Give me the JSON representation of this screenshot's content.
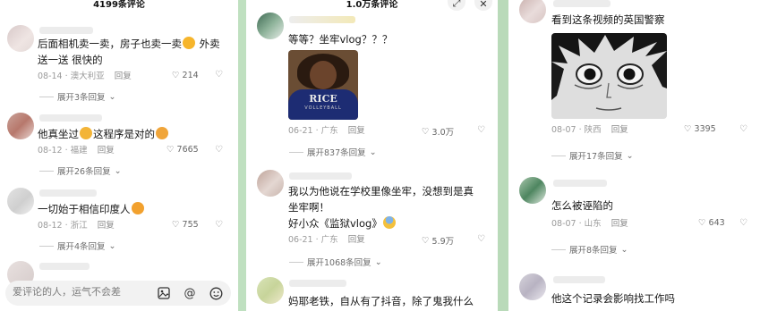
{
  "left": {
    "header": "4199条评论",
    "comments": [
      {
        "text": "后面相机卖一卖，房子也卖一卖",
        "emoji": "grinning-sweat-emoji",
        "text2": " 外卖",
        "line2": "送一送 很快的",
        "date": "08-14",
        "loc": "澳大利亚",
        "reply": "回复",
        "likes": "214",
        "expand": "展开3条回复"
      },
      {
        "text": "他真坐过",
        "emoji": "cold-sweat-emoji",
        "text2": "这程序是对的",
        "emoji2": "woozy-emoji",
        "date": "08-12",
        "loc": "福建",
        "reply": "回复",
        "likes": "7665",
        "expand": "展开26条回复"
      },
      {
        "text": "一切始于相信印度人",
        "emoji": "smirk-emoji",
        "date": "08-12",
        "loc": "浙江",
        "reply": "回复",
        "likes": "755",
        "expand": "展开4条回复"
      }
    ],
    "input_placeholder": "爱评论的人，运气不会差"
  },
  "middle": {
    "header": "1.0万条评论",
    "comments": [
      {
        "text": "等等？坐牢vlog？？？",
        "image_text": "RICE",
        "image_text2": "VOLLEYBALL",
        "date": "06-21",
        "loc": "广东",
        "reply": "回复",
        "likes": "3.0万",
        "expand": "展开837条回复"
      },
      {
        "line1": "我以为他说在学校里像坐牢，没想到是真",
        "line2": "坐牢啊！",
        "line3": "好小众《监狱vlog》",
        "emoji": "fearful-emoji",
        "date": "06-21",
        "loc": "广东",
        "reply": "回复",
        "likes": "5.9万",
        "expand": "展开1068条回复"
      },
      {
        "text": "妈耶老铁，自从有了抖音，除了鬼我什么"
      }
    ]
  },
  "right": {
    "comments": [
      {
        "text": "看到这条视频的英国警察",
        "date": "08-07",
        "loc": "陕西",
        "reply": "回复",
        "likes": "3395",
        "expand": "展开17条回复"
      },
      {
        "text": "怎么被诬陷的",
        "date": "08-07",
        "loc": "山东",
        "reply": "回复",
        "likes": "643",
        "expand": "展开8条回复"
      },
      {
        "text": "他这个记录会影响找工作吗"
      }
    ]
  },
  "colors": {
    "background": "#c6e3c3",
    "panel": "#ffffff",
    "meta": "#9a9a9a"
  }
}
